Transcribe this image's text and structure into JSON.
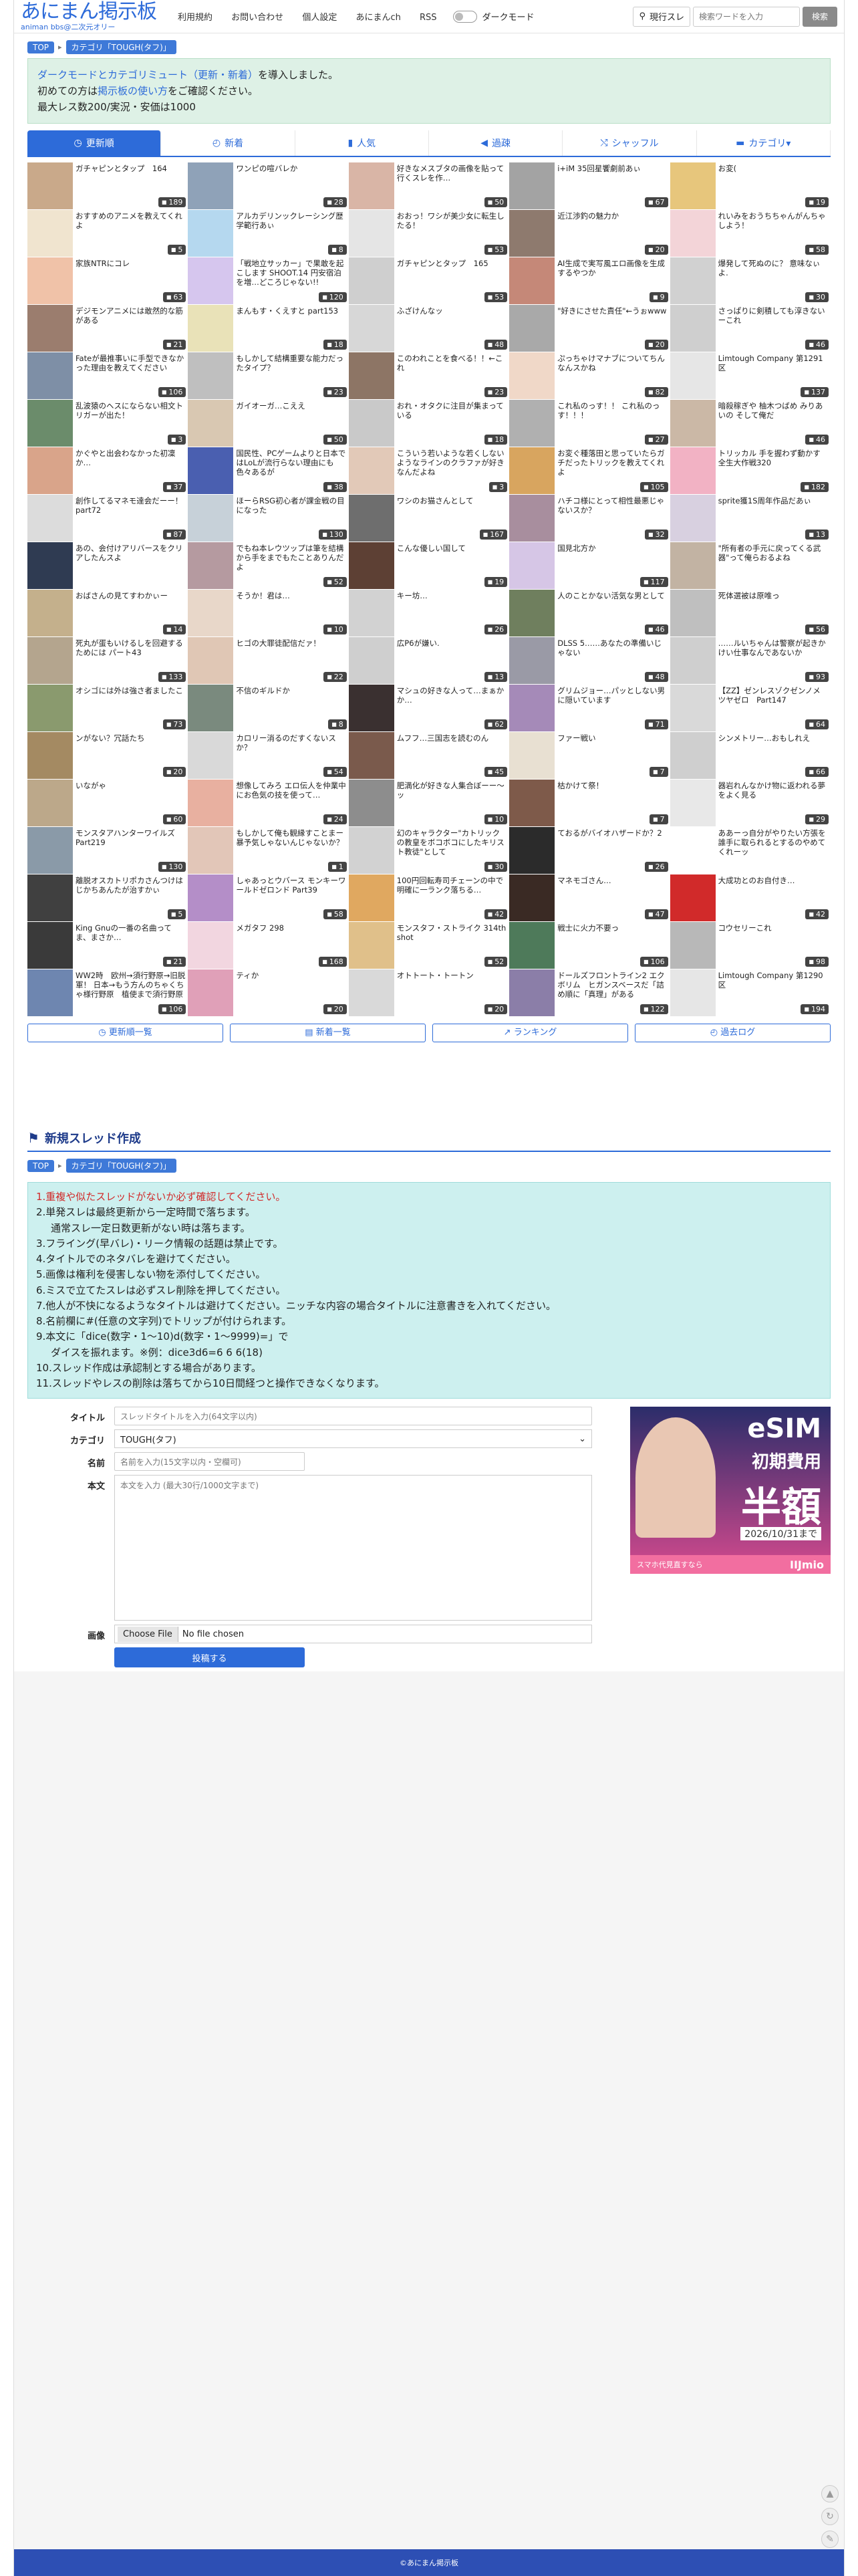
{
  "header": {
    "logo_main": "あにまん掲示板",
    "logo_sub": "animan bbs@二次元オリー",
    "nav": [
      "利用規約",
      "お問い合わせ",
      "個人設定",
      "あにまんch",
      "RSS"
    ],
    "dark_mode_label": "ダークモード",
    "search_mode": "現行スレ",
    "search_placeholder": "検索ワードを入力",
    "search_button": "検索"
  },
  "breadcrumb": {
    "top": "TOP",
    "category": "カテゴリ「TOUGH(タフ)」"
  },
  "notice": {
    "line1_a": "ダークモードとカテゴリミュート（更新・新着）",
    "line1_b": "を導入しました。",
    "line2_a": "初めての方は",
    "line2_link": "掲示板の使い方",
    "line2_b": "をご確認ください。",
    "line3": "最大レス数200/実況・安価は1000"
  },
  "tabs": [
    {
      "label": "更新順",
      "icon": "◷"
    },
    {
      "label": "新着",
      "icon": "◴"
    },
    {
      "label": "人気",
      "icon": "▮"
    },
    {
      "label": "過疎",
      "icon": "◀"
    },
    {
      "label": "シャッフル",
      "icon": "⤭"
    },
    {
      "label": "カテゴリ▾",
      "icon": "▬"
    }
  ],
  "threads": [
    {
      "t": "ガチャピンとタップ　164",
      "n": "189",
      "c": "#c9a98a"
    },
    {
      "t": "ワンピの喧バレか",
      "n": "28",
      "c": "#8fa2b8"
    },
    {
      "t": "好きなメスブタの画像を貼って行くスレを作…",
      "n": "50",
      "c": "#d9b5a6"
    },
    {
      "t": "i+iM 35回星饗劇前あぃ",
      "n": "67",
      "c": "#a3a3a3"
    },
    {
      "t": "お変(",
      "n": "19",
      "c": "#e7c67c"
    },
    {
      "t": "おすすめのアニメを教えてくれよ",
      "n": "5",
      "c": "#f0e4cf"
    },
    {
      "t": "アルカデリンックレーシング歴学範行あぃ",
      "n": "8",
      "c": "#b5d8ef"
    },
    {
      "t": "おおっ！ワシが美少女に転生したる！",
      "n": "53",
      "c": "#e5e5e5"
    },
    {
      "t": "近江渉釣の魅力か",
      "n": "20",
      "c": "#8e7a6e"
    },
    {
      "t": "れいみをおうちちゃんがんちゃしよう！",
      "n": "58",
      "c": "#f3d4d8"
    },
    {
      "t": "家族NTRにコレ",
      "n": "63",
      "c": "#f0c2a8"
    },
    {
      "t": "「戦地立サッカー」で果敢を起こします SHOOT.14 円安宿泊を増…どころじゃない!!",
      "n": "120",
      "c": "#d6c6ee"
    },
    {
      "t": "ガチャピンとタップ　165",
      "n": "53",
      "c": "#cfcfcf"
    },
    {
      "t": "AI生成で実写風エロ画像を生成するやつか",
      "n": "9",
      "c": "#c58878"
    },
    {
      "t": "爆発して死ぬのに？ 意味なぃよ.",
      "n": "30",
      "c": "#d1d1d1"
    },
    {
      "t": "デジモンアニメには敢然的な筋がある",
      "n": "21",
      "c": "#9b7d6e"
    },
    {
      "t": "まんもす・くえすと part153",
      "n": "18",
      "c": "#e9e2b8"
    },
    {
      "t": "ふざけんなッ",
      "n": "48",
      "c": "#d7d7d7"
    },
    {
      "t": "\"好きにさせた責任\"←うぉwww",
      "n": "20",
      "c": "#a9a9a9"
    },
    {
      "t": "さっぱりに剣積しても淳きないーこれ",
      "n": "46",
      "c": "#cfcfcf"
    },
    {
      "t": "Fateが最推事いに手型できなかった理由を教えてください",
      "n": "106",
      "c": "#7e8fa6"
    },
    {
      "t": "もしかして結構重要な能力だったタイプ？",
      "n": "23",
      "c": "#bfbfbf"
    },
    {
      "t": "このわれことを食べる！！←これ",
      "n": "23",
      "c": "#8d7565"
    },
    {
      "t": "ぷっちゃけマナブについてちんなんスかね",
      "n": "82",
      "c": "#f0d8c8"
    },
    {
      "t": "Limtough Company 第1291区",
      "n": "137",
      "c": "#e6e6e6"
    },
    {
      "t": "乱波猿のヘスにならない相文トリガーが出た！",
      "n": "3",
      "c": "#6b8c6b"
    },
    {
      "t": "ガイオーガ…こええ",
      "n": "50",
      "c": "#d9c8b2"
    },
    {
      "t": "おれ・オタクに注目が集まっている",
      "n": "18",
      "c": "#c9c9c9"
    },
    {
      "t": "これ私のっす！！ これ私のっす！！！",
      "n": "27",
      "c": "#b0b0b0"
    },
    {
      "t": "暗殺稼ぎや 柚木つばめ みりあいの そして俺だ",
      "n": "46",
      "c": "#cbb8a6"
    },
    {
      "t": "かぐやと出会わなかった初凜か…",
      "n": "37",
      "c": "#d9a48a"
    },
    {
      "t": "国民性、PCゲームよりと日本ではLoLが流行らない理由にも色々あるが",
      "n": "38",
      "c": "#4a5fb0"
    },
    {
      "t": "こういう若いような若くしないようなラインのクラファが好きなんだよね",
      "n": "3",
      "c": "#e2c9b8"
    },
    {
      "t": "お変ぐ種落田と思っていたらガチだったトリックを教えてくれよ",
      "n": "105",
      "c": "#d8a55f"
    },
    {
      "t": "トリッカル 手を握わず動かす全生大作戦320",
      "n": "182",
      "c": "#f2b2c4"
    },
    {
      "t": "創作してるマネモ達会だーー！ part72",
      "n": "87",
      "c": "#dcdcdc"
    },
    {
      "t": "ほーらRSG初心者が課金戦の目になった",
      "n": "130",
      "c": "#c7d1d9"
    },
    {
      "t": "ワシのお猫さんとして",
      "n": "167",
      "c": "#6e6e6e"
    },
    {
      "t": "ハチコ様にとって相性最悪じゃないスか？",
      "n": "32",
      "c": "#a88e9e"
    },
    {
      "t": "sprite獲1S周年作品だあぃ",
      "n": "13",
      "c": "#d8d0e0"
    },
    {
      "t": "あの、会付けアリバースをクリアしたんスよ",
      "n": "",
      "c": "#2f3b52"
    },
    {
      "t": "でもね本レウツップは筆を結構から手をまでもたことありんだよ",
      "n": "52",
      "c": "#b59aa0"
    },
    {
      "t": "こんな優しい国して",
      "n": "19",
      "c": "#5d4034"
    },
    {
      "t": "国見北方か",
      "n": "117",
      "c": "#d6c6e6"
    },
    {
      "t": "\"所有者の手元に戻ってくる武器\"って俺らおるよね",
      "n": "",
      "c": "#c2b3a3"
    },
    {
      "t": "おばさんの見てすわかぃー",
      "n": "14",
      "c": "#c4b08c"
    },
    {
      "t": "そうか！君は…",
      "n": "10",
      "c": "#e8d7c9"
    },
    {
      "t": "キー坊…",
      "n": "26",
      "c": "#d2d2d2"
    },
    {
      "t": "人のことかない活気な男として",
      "n": "46",
      "c": "#6f7f5e"
    },
    {
      "t": "死体選被は原唯っ",
      "n": "56",
      "c": "#bfbfbf"
    },
    {
      "t": "死丸が蛋もいけるしを回避するためには パート43",
      "n": "133",
      "c": "#b4a58e"
    },
    {
      "t": "ヒゴの大罪徒配信だァ！",
      "n": "22",
      "c": "#e0c7b5"
    },
    {
      "t": "広P6が嫌い.",
      "n": "13",
      "c": "#cfcfcf"
    },
    {
      "t": "DLSS 5……あなたの準備いじゃない",
      "n": "48",
      "c": "#9a9aa6"
    },
    {
      "t": "……ルいちゃんは警察が起きかけい仕事なんであないか",
      "n": "93",
      "c": "#cfcfcf"
    },
    {
      "t": "オシゴには外は強さ者ましたこ",
      "n": "73",
      "c": "#8a9a6e"
    },
    {
      "t": "不信のギルドか",
      "n": "8",
      "c": "#7a8a7e"
    },
    {
      "t": "マシュの好きな人って…まぁかか…",
      "n": "62",
      "c": "#3a3030"
    },
    {
      "t": "グリムジョー…パッとしない男に隠いています",
      "n": "71",
      "c": "#a58ab8"
    },
    {
      "t": "【ZZ】ゼンレスゾクゼンノメツヤゼロ　Part147",
      "n": "64",
      "c": "#d9d9d9"
    },
    {
      "t": "ンがない？冗話たち",
      "n": "20",
      "c": "#a48a62"
    },
    {
      "t": "カロリー消るのだすくないスか？",
      "n": "54",
      "c": "#d9d9d9"
    },
    {
      "t": "ムフフ…三国志を読むのん",
      "n": "45",
      "c": "#7a5a4c"
    },
    {
      "t": "ファー戦い",
      "n": "7",
      "c": "#e8e0d2"
    },
    {
      "t": "シンメトリー…おもしれえ",
      "n": "66",
      "c": "#cfcfcf"
    },
    {
      "t": "いながゃ",
      "n": "60",
      "c": "#bca88a"
    },
    {
      "t": "想像してみろ エロ伝人を仲業中にお色気の技を使って…",
      "n": "24",
      "c": "#e8b0a0"
    },
    {
      "t": "肥満化が好きな人集合ぼーー〜ッ",
      "n": "10",
      "c": "#8d8d8d"
    },
    {
      "t": "枯かけて祭！",
      "n": "7",
      "c": "#7e5a4a"
    },
    {
      "t": "器岩れんなかけ物に返われる夢をよく見る",
      "n": "29",
      "c": "#e8e8e8"
    },
    {
      "t": "モンスタアハンターワイルズ Part219",
      "n": "130",
      "c": "#8a9aa8"
    },
    {
      "t": "もしかして俺も観縁すことまー暴予気しゃないんじゃないか？",
      "n": "1",
      "c": "#e2c6b8"
    },
    {
      "t": "幻のキャラクター\"カトリックの教皇をボコボコにしたキリスト教徒\"として",
      "n": "30",
      "c": "#d2d2d2"
    },
    {
      "t": "ておるがバイオハザードか？2",
      "n": "26",
      "c": "#2b2b2b"
    },
    {
      "t": "ああーっ自分がやりたい方張を誰手に取られるとするのやめてくれーッ",
      "n": "",
      "c": "#ffffff"
    },
    {
      "t": "離脱オスカトリポカさんつけはじかちあんたが治すかぃ",
      "n": "5",
      "c": "#404040"
    },
    {
      "t": "しゃあっとウバース モンキーワールドゼロンド Part39",
      "n": "58",
      "c": "#b48ec8"
    },
    {
      "t": "100円回転寿司チェーンの中で明確に一ランク落ちる…",
      "n": "42",
      "c": "#e0a860"
    },
    {
      "t": "マネモゴさん…",
      "n": "47",
      "c": "#3a2a24"
    },
    {
      "t": "大成功とのお自付き…",
      "n": "42",
      "c": "#d12a2a"
    },
    {
      "t": "King Gnuの一番の名曲ってま、まさか…",
      "n": "21",
      "c": "#3a3a3a"
    },
    {
      "t": "メガタフ 298",
      "n": "168",
      "c": "#f2d6e0"
    },
    {
      "t": "モンスタフ・ストライク 314th shot",
      "n": "52",
      "c": "#e0c08a"
    },
    {
      "t": "戦士に火力不要っ",
      "n": "106",
      "c": "#4e7a5a"
    },
    {
      "t": "コウセリーこれ",
      "n": "98",
      "c": "#b8b8b8"
    },
    {
      "t": "WW2時　欧州→須行野原→旧脱軍！ 日本→もう方んのちゃくちゃ様行野原　植使まで須行野原",
      "n": "106",
      "c": "#6e86b0"
    },
    {
      "t": "ティか",
      "n": "20",
      "c": "#e0a0b8"
    },
    {
      "t": "オトトート・トートン",
      "n": "20",
      "c": "#d9d9d9"
    },
    {
      "t": "ドールズフロントライン2 エクボリム　ヒガンスベースだ「詰め順に「真理」がある",
      "n": "122",
      "c": "#8b7ea8"
    },
    {
      "t": "Limtough Company 第1290区",
      "n": "194",
      "c": "#e6e6e6"
    }
  ],
  "bottom_nav": [
    {
      "label": "更新順一覧",
      "icon": "◷"
    },
    {
      "label": "新着一覧",
      "icon": "▤"
    },
    {
      "label": "ランキング",
      "icon": "↗"
    },
    {
      "label": "過去ログ",
      "icon": "◴"
    }
  ],
  "new_thread": {
    "title": "新規スレッド作成",
    "rules": [
      "1.重複や似たスレッドがないか必ず確認してください。",
      "2.単発スレは最終更新から一定時間で落ちます。",
      "通常スレ一定日数更新がない時は落ちます。",
      "3.フライング(早バレ)・リーク情報の話題は禁止です。",
      "4.タイトルでのネタバレを避けてください。",
      "5.画像は権利を侵害しない物を添付してください。",
      "6.ミスで立てたスレは必ずスレ削除を押してください。",
      "7.他人が不快になるようなタイトルは避けてください。ニッチな内容の場合タイトルに注意書きを入れてください。",
      "8.名前欄に#(任意の文字列)でトリップが付けられます。",
      "9.本文に「dice(数字・1〜10)d(数字・1〜9999)=」で",
      "ダイスを振れます。※例：dice3d6=6 6 6(18)",
      "10.スレッド作成は承認制とする場合があります。",
      "11.スレッドやレスの削除は落ちてから10日間経つと操作できなくなります。"
    ],
    "labels": {
      "title": "タイトル",
      "category": "カテゴリ",
      "name": "名前",
      "body": "本文",
      "image": "画像"
    },
    "title_placeholder": "スレッドタイトルを入力(64文字以内)",
    "category_value": "TOUGH(タフ)",
    "name_placeholder": "名前を入力(15文字以内・空欄可)",
    "body_placeholder": "本文を入力 (最大30行/1000文字まで)",
    "file_button": "Choose File",
    "file_status": "No file chosen",
    "submit": "投稿する"
  },
  "ad": {
    "line1": "eSIM",
    "line2": "初期費用",
    "line3": "半額",
    "line4": "2026/10/31まで",
    "line5": "スマホ代見直すなら",
    "line6": "IIJmio"
  },
  "footer": "©あにまん掲示板"
}
